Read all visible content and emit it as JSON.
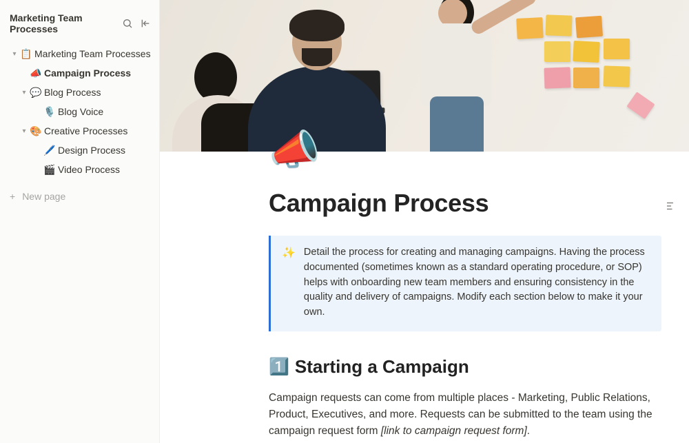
{
  "sidebar": {
    "workspace_title": "Marketing Team Processes",
    "new_page_label": "New page",
    "items": [
      {
        "icon": "📋",
        "label": "Marketing Team Processes",
        "depth": 0,
        "expanded": true,
        "active": false,
        "has_children": true
      },
      {
        "icon": "📣",
        "label": "Campaign Process",
        "depth": 1,
        "expanded": false,
        "active": true,
        "has_children": false
      },
      {
        "icon": "💬",
        "label": "Blog Process",
        "depth": 1,
        "expanded": true,
        "active": false,
        "has_children": true
      },
      {
        "icon": "🎙️",
        "label": "Blog Voice",
        "depth": 2,
        "expanded": false,
        "active": false,
        "has_children": false
      },
      {
        "icon": "🎨",
        "label": "Creative Processes",
        "depth": 1,
        "expanded": true,
        "active": false,
        "has_children": true
      },
      {
        "icon": "🖊️",
        "label": "Design Process",
        "depth": 2,
        "expanded": false,
        "active": false,
        "has_children": false
      },
      {
        "icon": "🎬",
        "label": "Video Process",
        "depth": 2,
        "expanded": false,
        "active": false,
        "has_children": false
      }
    ]
  },
  "page": {
    "emoji": "📣",
    "title": "Campaign Process",
    "callout_icon": "✨",
    "callout_text": "Detail the process for creating and managing campaigns. Having the process documented (sometimes known as a standard operating procedure, or SOP) helps with onboarding new team members and ensuring consistency in the quality and delivery of campaigns. Modify each section below to make it your own.",
    "section1_icon": "1️⃣",
    "section1_title": "Starting a Campaign",
    "section1_body_plain": "Campaign requests can come from multiple places - Marketing, Public Relations, Product, Executives, and more. Requests can be submitted to the team using the campaign request form ",
    "section1_body_link": "[link to campaign request form]",
    "section1_body_tail": "."
  }
}
